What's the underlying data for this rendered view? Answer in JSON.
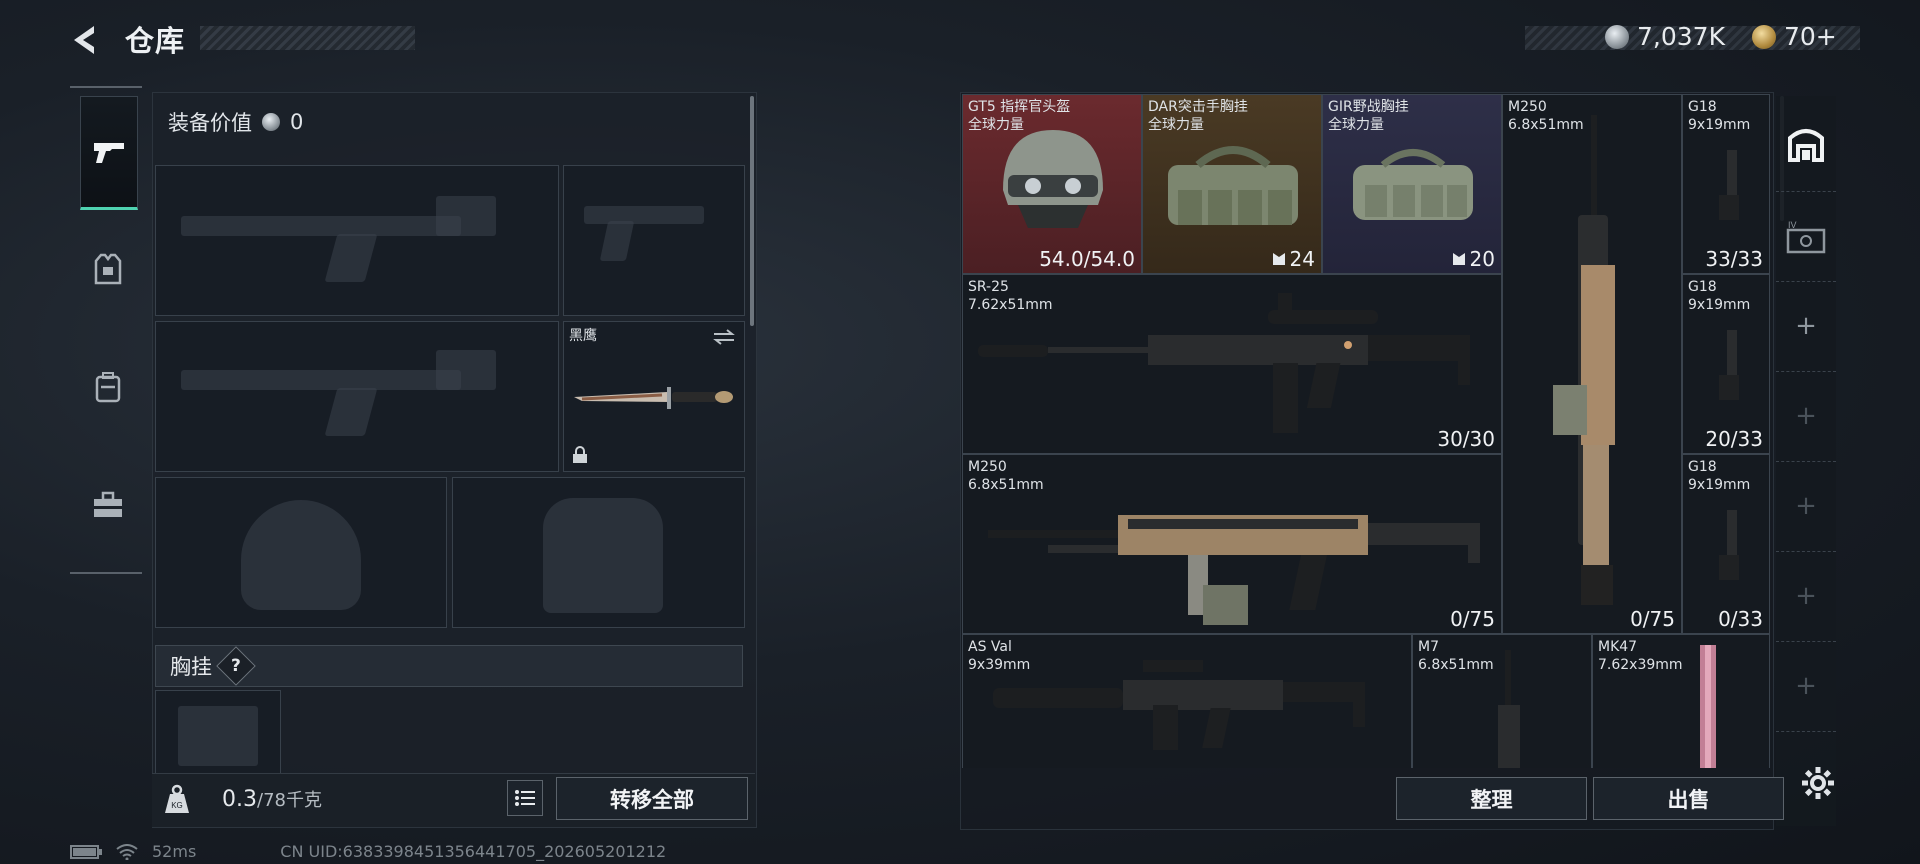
{
  "header": {
    "title": "仓库",
    "silver": "7,037K",
    "gold": "70+"
  },
  "equipment": {
    "value_label": "装备价值",
    "value": "0",
    "melee_name": "黑鹰",
    "chest_label": "胸挂",
    "help": "?",
    "weight_current": "0.3",
    "weight_max": "/78千克",
    "transfer_all": "转移全部"
  },
  "stash": {
    "items": [
      {
        "name": "GT5 指挥官头盔",
        "sub": "全球力量",
        "count": "54.0/54.0"
      },
      {
        "name": "DAR突击手胸挂",
        "sub": "全球力量",
        "count": "24"
      },
      {
        "name": "GIR野战胸挂",
        "sub": "全球力量",
        "count": "20"
      },
      {
        "name": "M250",
        "sub": "6.8x51mm",
        "count": "0/75"
      },
      {
        "name": "G18",
        "sub": "9x19mm",
        "count": "33/33"
      },
      {
        "name": "SR-25",
        "sub": "7.62x51mm",
        "count": "30/30"
      },
      {
        "name": "G18",
        "sub": "9x19mm",
        "count": "20/33"
      },
      {
        "name": "M250",
        "sub": "6.8x51mm",
        "count": "0/75"
      },
      {
        "name": "G18",
        "sub": "9x19mm",
        "count": "0/33"
      },
      {
        "name": "AS Val",
        "sub": "9x39mm",
        "count": ""
      },
      {
        "name": "M7",
        "sub": "6.8x51mm",
        "count": ""
      },
      {
        "name": "MK47",
        "sub": "7.62x39mm",
        "count": ""
      }
    ],
    "sort_button": "整理",
    "sell_button": "出售"
  },
  "status": {
    "ping": "52ms",
    "uid": "CN UID:6383398451356441705_202605201212"
  },
  "colors": {
    "accent": "#4fd3b0",
    "rarity_red": "#6b2a2e",
    "rarity_gold": "#4a3a24",
    "rarity_purple": "#2e2f48"
  }
}
